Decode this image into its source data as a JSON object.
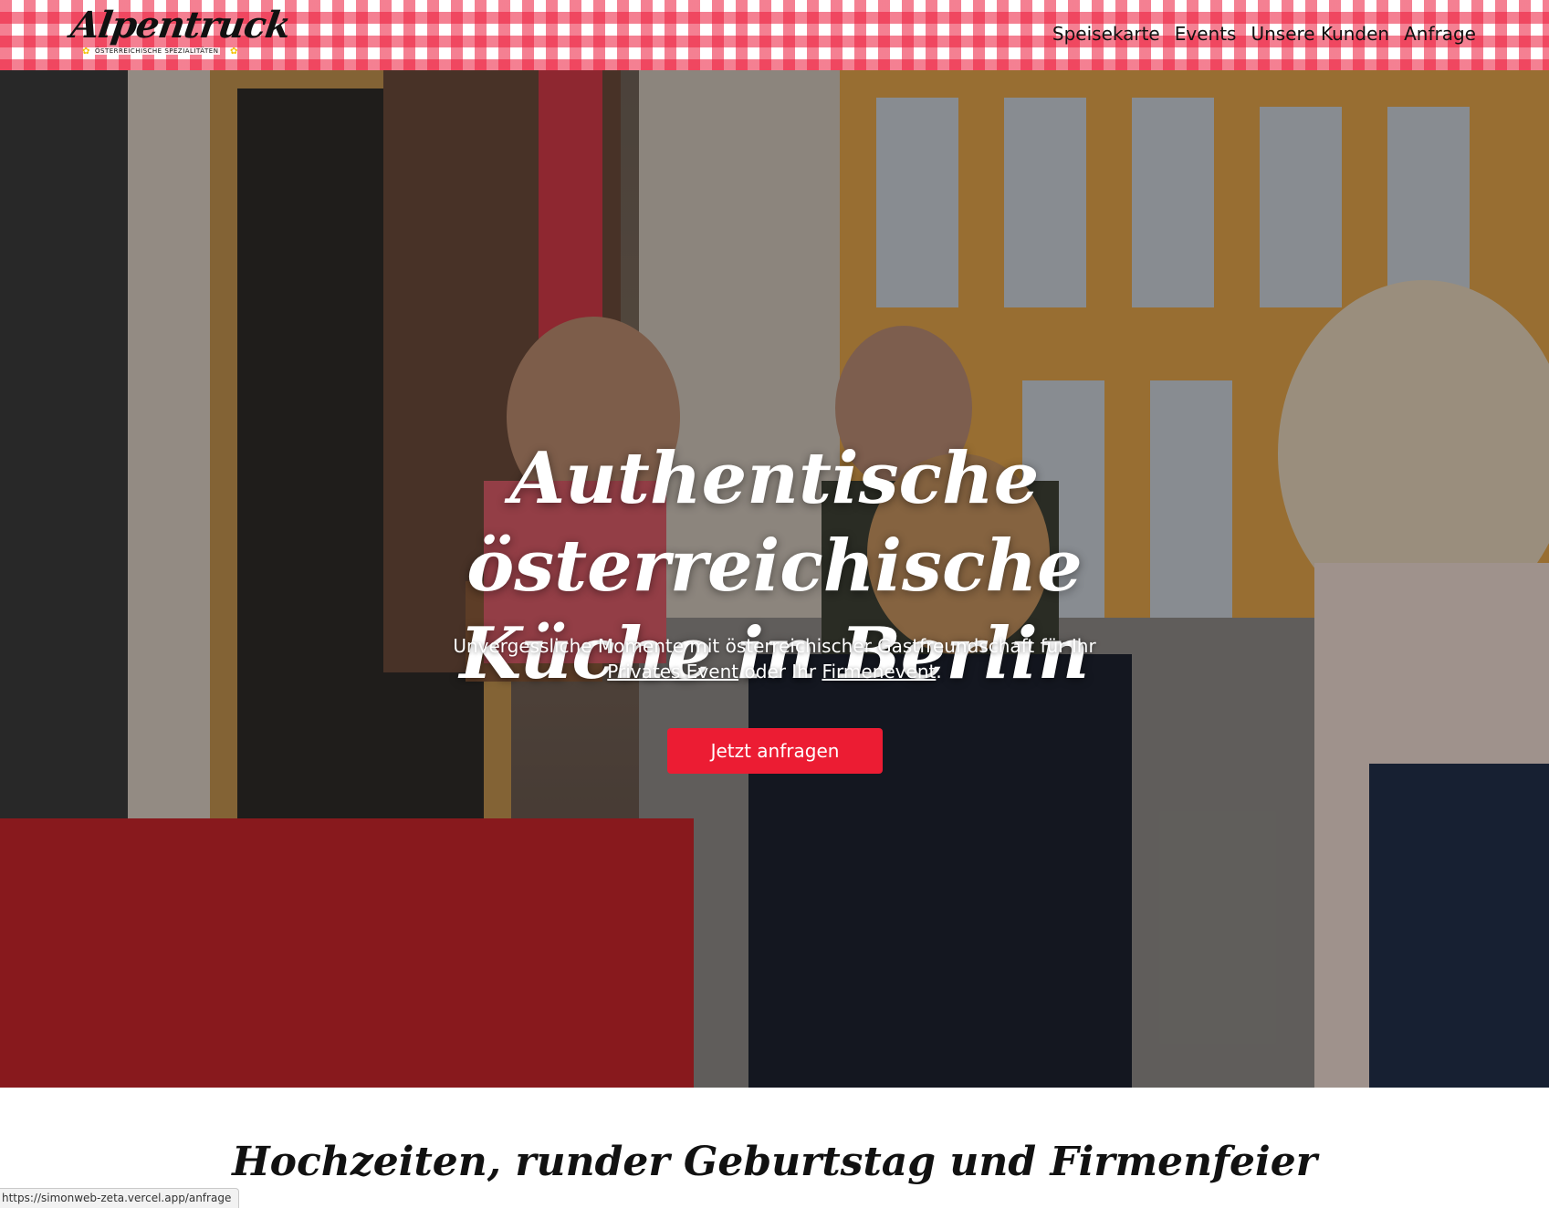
{
  "header": {
    "logo_text": "Alpentruck",
    "logo_subtitle": "ÖSTERREICHISCHE SPEZIALITÄTEN",
    "nav": [
      {
        "label": "Speisekarte"
      },
      {
        "label": "Events"
      },
      {
        "label": "Unsere Kunden"
      },
      {
        "label": "Anfrage"
      }
    ]
  },
  "hero": {
    "title": "Authentische österreichische Küche in Berlin",
    "subtitle_part1": "Unvergessliche Momente mit österreichischer Gastfreundschaft für Ihr",
    "link_private": "Privates Event",
    "subtitle_mid": "oder Ihr",
    "link_company": "Firmenevent",
    "subtitle_end": ".",
    "cta_label": "Jetzt anfragen"
  },
  "section": {
    "heading": "Hochzeiten, runder Geburtstag und Firmenfeier"
  },
  "status_bar": {
    "url": "https://simonweb-zeta.vercel.app/anfrage"
  },
  "colors": {
    "brand_red": "#ec1c33",
    "gingham_red": "#ec1838",
    "text_dark": "#111111",
    "white": "#ffffff"
  },
  "icons": [
    "edelweiss-icon"
  ]
}
